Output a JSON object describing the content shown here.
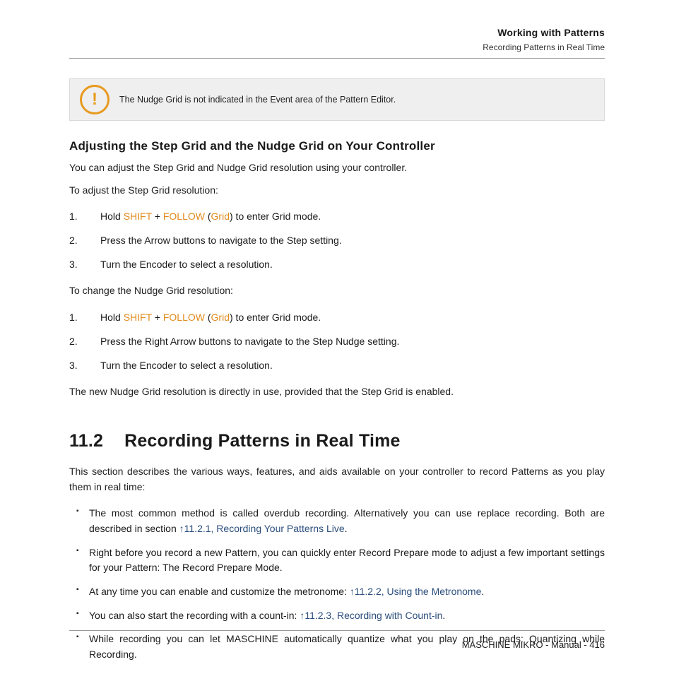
{
  "header": {
    "title": "Working with Patterns",
    "subtitle": "Recording Patterns in Real Time"
  },
  "callout": {
    "text": "The Nudge Grid is not indicated in the Event area of the Pattern Editor."
  },
  "subheading1": "Adjusting the Step Grid and the Nudge Grid on Your Controller",
  "intro1": "You can adjust the Step Grid and Nudge Grid resolution using your controller.",
  "lead1": "To adjust the Step Grid resolution:",
  "steps1": {
    "s1a": "Hold ",
    "s1_shift": "SHIFT",
    "s1_plus": " + ",
    "s1_follow": "FOLLOW",
    "s1b": " (",
    "s1_grid": "Grid",
    "s1c": ") to enter Grid mode.",
    "s2": "Press the Arrow buttons to navigate to the Step setting.",
    "s3": "Turn the Encoder to select a resolution."
  },
  "lead2": "To change the Nudge Grid resolution:",
  "steps2": {
    "s1a": "Hold ",
    "s1_shift": "SHIFT",
    "s1_plus": " + ",
    "s1_follow": "FOLLOW",
    "s1b": " (",
    "s1_grid": "Grid",
    "s1c": ") to enter Grid mode.",
    "s2": "Press the Right Arrow buttons to navigate to the Step Nudge setting.",
    "s3": "Turn the Encoder to select a resolution."
  },
  "after_steps": "The new Nudge Grid resolution is directly in use, provided that the Step Grid is enabled.",
  "section": {
    "num": "11.2",
    "title": "Recording Patterns in Real Time"
  },
  "section_intro": "This section describes the various ways, features, and aids available on your controller to record Patterns as you play them in real time:",
  "bullets": {
    "b1a": "The most common method is called overdub recording. Alternatively you can use replace recording. Both are described in section ",
    "b1_link": "↑11.2.1, Recording Your Patterns Live",
    "b1b": ".",
    "b2": "Right before you record a new Pattern, you can quickly enter Record Prepare mode to adjust a few important settings for your Pattern: The Record Prepare Mode.",
    "b3a": "At any time you can enable and customize the metronome: ",
    "b3_link": "↑11.2.2, Using the Metronome",
    "b3b": ".",
    "b4a": "You can also start the recording with a count-in: ",
    "b4_link": "↑11.2.3, Recording with Count-in",
    "b4b": ".",
    "b5": "While recording you can let MASCHINE automatically quantize what you play on the pads: Quantizing while Recording."
  },
  "footer": "MASCHINE MIKRO - Manual - 416"
}
